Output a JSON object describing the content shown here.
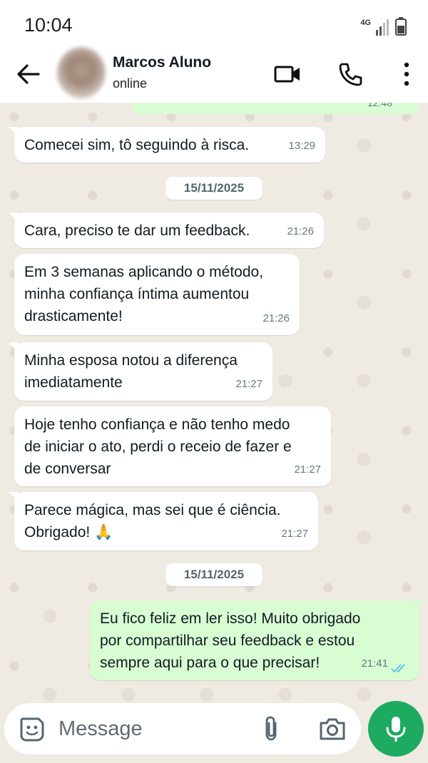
{
  "status_bar": {
    "time": "10:04",
    "network": "4G"
  },
  "header": {
    "contact_name": "Marcos Aluno",
    "contact_status": "online"
  },
  "chat": {
    "previous_time": "12:48",
    "messages": [
      {
        "text": "Comecei sim, tô seguindo à risca.",
        "time": "13:29"
      },
      {
        "date": "15/11/2025"
      },
      {
        "text": "Cara, preciso te dar um feedback.",
        "time": "21:26"
      },
      {
        "lines": [
          "Em 3 semanas aplicando o método,",
          "minha confiança íntima aumentou",
          "drasticamente!"
        ],
        "time": "21:26"
      },
      {
        "lines": [
          "Minha esposa notou a diferença",
          "imediatamente"
        ],
        "time": "21:27"
      },
      {
        "lines": [
          "Hoje tenho confiança e não tenho medo",
          "de iniciar o ato, perdi o receio de fazer e",
          "de conversar"
        ],
        "time": "21:27"
      },
      {
        "lines": [
          "Parece mágica, mas sei que é ciência.",
          "Obrigado! 🙏"
        ],
        "time": "21:27"
      },
      {
        "date": "15/11/2025"
      },
      {
        "outgoing": true,
        "lines": [
          "Eu fico feliz em ler isso! Muito obrigado",
          "por compartilhar seu feedback e estou",
          "sempre aqui para o que precisar!"
        ],
        "time": "21:41",
        "status": "read"
      }
    ]
  },
  "input": {
    "placeholder": "Message"
  },
  "colors": {
    "incoming": "#ffffff",
    "outgoing": "#d9fdd3",
    "accent": "#1daa61",
    "read_ticks": "#53bdeb"
  },
  "icons": [
    "back-arrow-icon",
    "video-call-icon",
    "phone-icon",
    "more-vert-icon",
    "sticker-icon",
    "attach-icon",
    "camera-icon",
    "mic-icon",
    "double-check-icon"
  ]
}
